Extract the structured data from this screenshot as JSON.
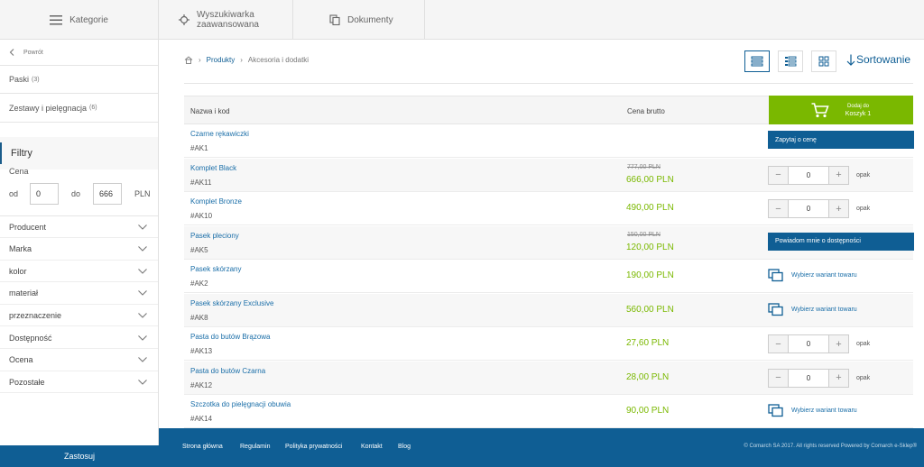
{
  "topbar": {
    "categories": "Kategorie",
    "advanced_search": "Wyszukiwarka zaawansowana",
    "documents": "Dokumenty"
  },
  "sidebar": {
    "back": "Powrót",
    "categories": [
      {
        "label": "Paski",
        "count": "(3)"
      },
      {
        "label": "Zestawy i pielęgnacja",
        "count": "(6)"
      }
    ],
    "filters_title": "Filtry",
    "price_label": "Cena",
    "from_label": "od",
    "from_value": "0",
    "to_label": "do",
    "to_value": "666",
    "currency": "PLN",
    "filters": [
      "Producent",
      "Marka",
      "kolor",
      "materiał",
      "przeznaczenie",
      "Dostępność",
      "Ocena",
      "Pozostałe"
    ],
    "apply": "Zastosuj"
  },
  "breadcrumb": {
    "products": "Produkty",
    "current": "Akcesoria i dodatki"
  },
  "sort_label": "Sortowanie",
  "table": {
    "col_name": "Nazwa i kod",
    "col_price": "Cena brutto",
    "cart_line1": "Dodaj do",
    "cart_line2": "Koszyk 1"
  },
  "products": [
    {
      "name": "Czarne rękawiczki",
      "code": "#AK1",
      "price": "",
      "old_price": "",
      "action": "Zapytaj o cenę"
    },
    {
      "name": "Komplet Black",
      "code": "#AK11",
      "price": "666,00 PLN",
      "old_price": "777,00 PLN",
      "qty": "0",
      "unit": "opak"
    },
    {
      "name": "Komplet Bronze",
      "code": "#AK10",
      "price": "490,00 PLN",
      "old_price": "",
      "qty": "0",
      "unit": "opak"
    },
    {
      "name": "Pasek pleciony",
      "code": "#AK5",
      "price": "120,00 PLN",
      "old_price": "150,00 PLN",
      "action": "Powiadom mnie o dostępności"
    },
    {
      "name": "Pasek skórzany",
      "code": "#AK2",
      "price": "190,00 PLN",
      "old_price": "",
      "variant": "Wybierz wariant towaru"
    },
    {
      "name": "Pasek skórzany Exclusive",
      "code": "#AK8",
      "price": "560,00 PLN",
      "old_price": "",
      "variant": "Wybierz wariant towaru"
    },
    {
      "name": "Pasta do butów Brązowa",
      "code": "#AK13",
      "price": "27,60 PLN",
      "old_price": "",
      "qty": "0",
      "unit": "opak"
    },
    {
      "name": "Pasta do butów Czarna",
      "code": "#AK12",
      "price": "28,00 PLN",
      "old_price": "",
      "qty": "0",
      "unit": "opak"
    },
    {
      "name": "Szczotka do pielęgnacji obuwia",
      "code": "#AK14",
      "price": "90,00 PLN",
      "old_price": "",
      "variant": "Wybierz wariant towaru"
    }
  ],
  "footer": {
    "links": [
      "Strona główna",
      "Regulamin",
      "Polityka prywatności",
      "Kontakt",
      "Blog"
    ],
    "copyright": "© Comarch SA 2017. All rights reserved Powered by Comarch e-Sklep®"
  },
  "colors": {
    "accent_blue": "#0f5e94",
    "accent_green": "#7ab800"
  }
}
